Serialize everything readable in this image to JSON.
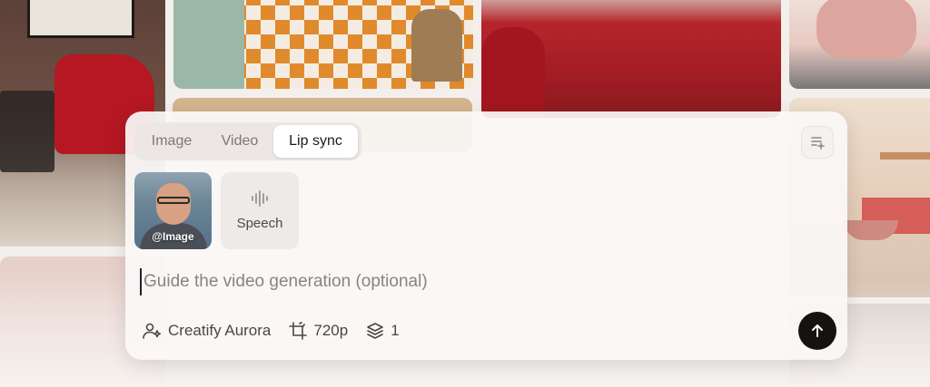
{
  "tabs": [
    {
      "label": "Image",
      "active": false
    },
    {
      "label": "Video",
      "active": false
    },
    {
      "label": "Lip sync",
      "active": true
    }
  ],
  "media": {
    "image_tag": "@Image",
    "speech_label": "Speech"
  },
  "prompt": {
    "value": "",
    "placeholder": "Guide the video generation (optional)"
  },
  "options": {
    "model": "Creatify Aurora",
    "resolution": "720p",
    "count": "1"
  },
  "icons": {
    "corner": "playlist-add-icon",
    "speech": "waveform-icon",
    "model": "user-sparkle-icon",
    "resolution": "crop-resize-icon",
    "count": "layers-icon",
    "send": "arrow-up-icon"
  },
  "colors": {
    "send_button": "#151312",
    "active_tab_bg": "#ffffff"
  }
}
